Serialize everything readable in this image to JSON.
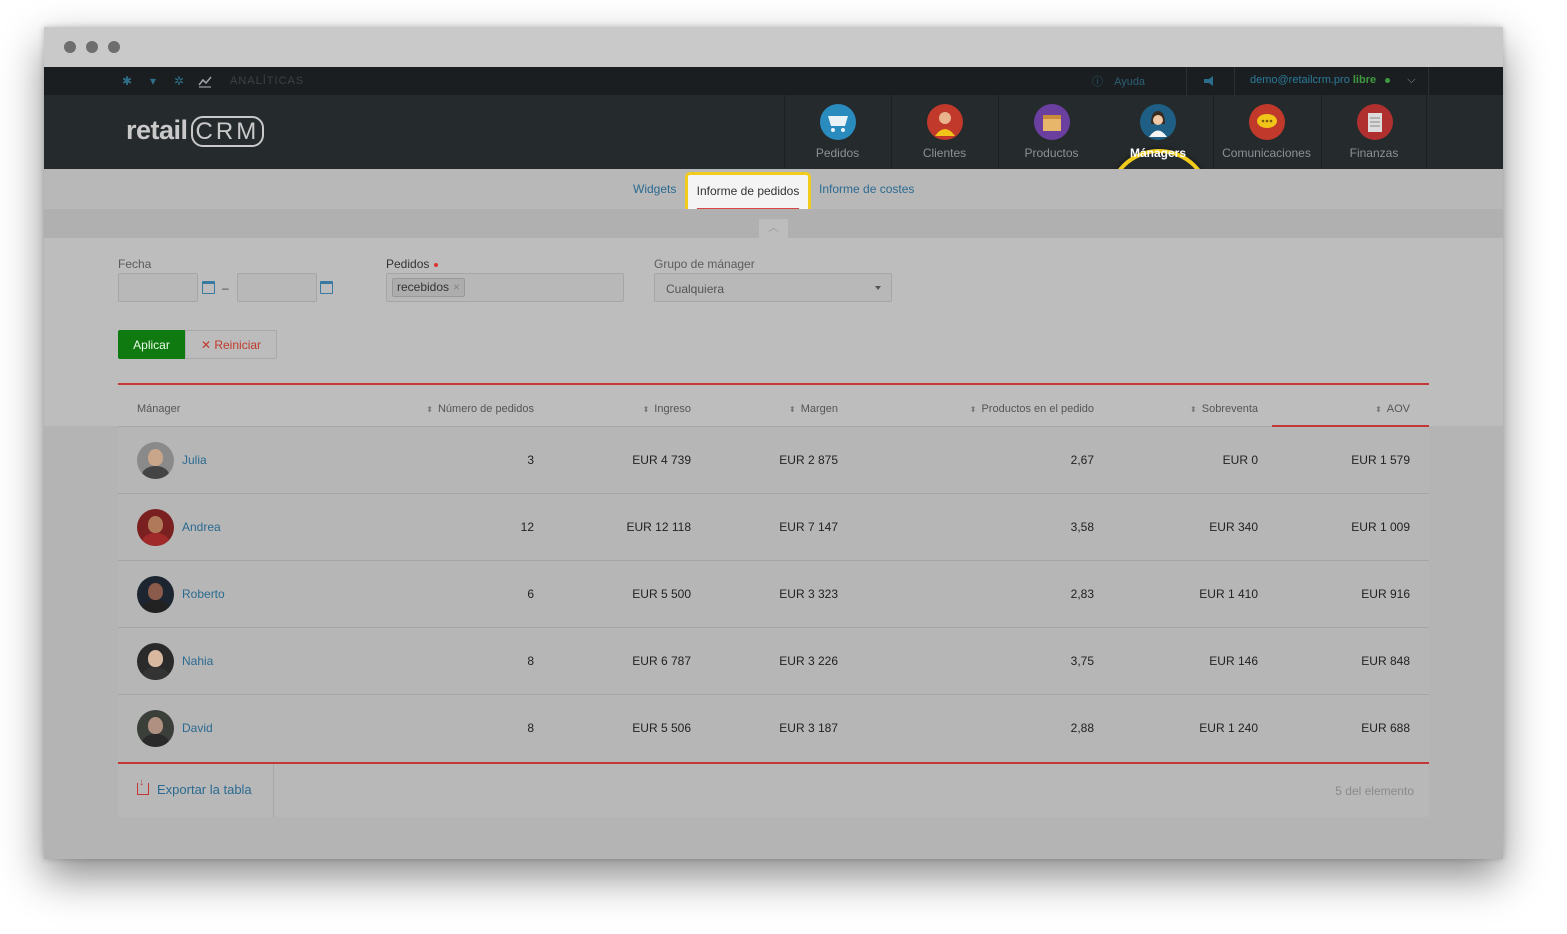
{
  "utilbar": {
    "analytics_label": "ANALÍTICAS",
    "help_label": "Ayuda",
    "user_email": "demo@retailcrm.pro",
    "plan_label": "libre"
  },
  "brand": {
    "logo_text": "retail",
    "logo_crm": "CRM"
  },
  "nav": {
    "items": [
      {
        "label": "Pedidos",
        "icon": "cart-icon",
        "color": "#2a8bbf"
      },
      {
        "label": "Clientes",
        "icon": "person-icon",
        "color": "#c0392b"
      },
      {
        "label": "Productos",
        "icon": "box-icon",
        "color": "#6b3fa0"
      },
      {
        "label": "Mánagers",
        "icon": "manager-icon",
        "color": "#1f5f86"
      },
      {
        "label": "Comunicaciones",
        "icon": "chat-icon",
        "color": "#c0392b"
      },
      {
        "label": "Finanzas",
        "icon": "finance-icon",
        "color": "#b03030"
      }
    ],
    "active": "Mánagers"
  },
  "subnav": {
    "widgets": "Widgets",
    "orders_report": "Informe de pedidos",
    "costs_report": "Informe de costes"
  },
  "filters": {
    "date_label": "Fecha",
    "date_separator": "–",
    "orders_label": "Pedidos",
    "orders_tag": "recebidos",
    "group_label": "Grupo de mánager",
    "group_value": "Cualquiera",
    "apply_label": "Aplicar",
    "reset_label": "Reiniciar"
  },
  "table": {
    "headers": {
      "manager": "Mánager",
      "orders": "Número de pedidos",
      "revenue": "Ingreso",
      "margin": "Margen",
      "products": "Productos en el pedido",
      "upsell": "Sobreventa",
      "aov": "AOV"
    },
    "rows": [
      {
        "name": "Julia",
        "orders": "3",
        "revenue": "EUR 4 739",
        "margin": "EUR 2 875",
        "products": "2,67",
        "upsell": "EUR 0",
        "aov": "EUR 1 579"
      },
      {
        "name": "Andrea",
        "orders": "12",
        "revenue": "EUR 12 118",
        "margin": "EUR 7 147",
        "products": "3,58",
        "upsell": "EUR 340",
        "aov": "EUR 1 009"
      },
      {
        "name": "Roberto",
        "orders": "6",
        "revenue": "EUR 5 500",
        "margin": "EUR 3 323",
        "products": "2,83",
        "upsell": "EUR 1 410",
        "aov": "EUR 916"
      },
      {
        "name": "Nahia",
        "orders": "8",
        "revenue": "EUR 6 787",
        "margin": "EUR 3 226",
        "products": "3,75",
        "upsell": "EUR 146",
        "aov": "EUR 848"
      },
      {
        "name": "David",
        "orders": "8",
        "revenue": "EUR 5 506",
        "margin": "EUR 3 187",
        "products": "2,88",
        "upsell": "EUR 1 240",
        "aov": "EUR 688"
      }
    ],
    "export_label": "Exportar la tabla",
    "count_label": "5 del elemento"
  },
  "colors": {
    "accent_red": "#c23838",
    "link_blue": "#2b6a90",
    "apply_green": "#0e7a10",
    "highlight_yellow": "#f2cc1c"
  }
}
